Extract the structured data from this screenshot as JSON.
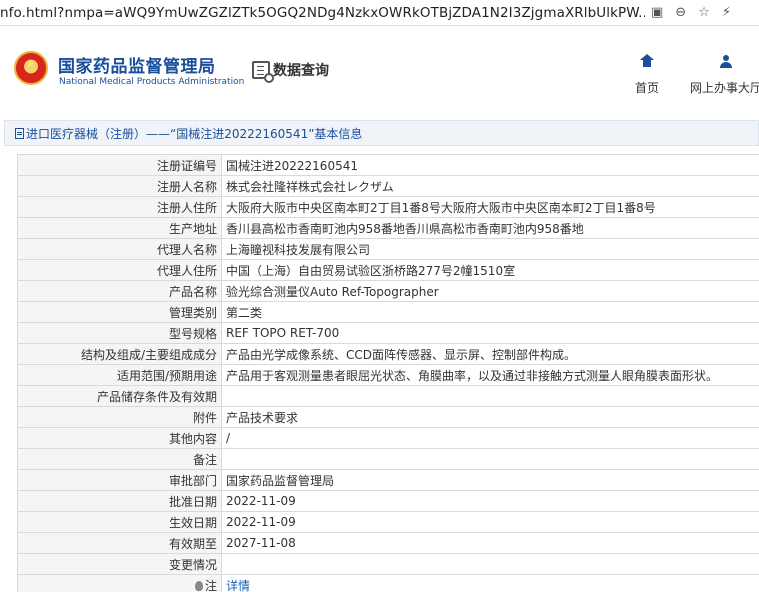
{
  "browser": {
    "url": "nfo.html?nmpa=aWQ9YmUwZGZlZTk5OGQ2NDg4NzkxOWRkOTBjZDA1N2I3ZjgmaXRlbUlkPW...",
    "icons": [
      "image-icon",
      "zoom-icon",
      "bookmark-star-icon",
      "extension-icon"
    ]
  },
  "header": {
    "org_name_cn": "国家药品监督管理局",
    "org_name_en": "National Medical Products Administration",
    "query_label": "数据查询",
    "nav": [
      {
        "label": "首页",
        "icon": "home-icon"
      },
      {
        "label": "网上办事大厅",
        "icon": "user-icon"
      }
    ]
  },
  "breadcrumb": {
    "text": "进口医疗器械（注册）——“国械注进20222160541”基本信息"
  },
  "details": [
    {
      "label": "注册证编号",
      "value": "国械注进20222160541"
    },
    {
      "label": "注册人名称",
      "value": "株式会社隆祥株式会社レクザム"
    },
    {
      "label": "注册人住所",
      "value": "大阪府大阪市中央区南本町2丁目1番8号大阪府大阪市中央区南本町2丁目1番8号"
    },
    {
      "label": "生产地址",
      "value": "香川县高松市香南町池内958番地香川県高松市香南町池内958番地"
    },
    {
      "label": "代理人名称",
      "value": "上海瞳视科技发展有限公司"
    },
    {
      "label": "代理人住所",
      "value": "中国（上海）自由贸易试验区浙桥路277号2幢1510室"
    },
    {
      "label": "产品名称",
      "value": "验光综合测量仪Auto Ref-Topographer"
    },
    {
      "label": "管理类别",
      "value": "第二类"
    },
    {
      "label": "型号规格",
      "value": "REF TOPO RET-700"
    },
    {
      "label": "结构及组成/主要组成成分",
      "value": "产品由光学成像系统、CCD面阵传感器、显示屏、控制部件构成。"
    },
    {
      "label": "适用范围/预期用途",
      "value": "产品用于客观测量患者眼屈光状态、角膜曲率，以及通过非接触方式测量人眼角膜表面形状。"
    },
    {
      "label": "产品储存条件及有效期",
      "value": ""
    },
    {
      "label": "附件",
      "value": "产品技术要求"
    },
    {
      "label": "其他内容",
      "value": "/"
    },
    {
      "label": "备注",
      "value": ""
    },
    {
      "label": "审批部门",
      "value": "国家药品监督管理局"
    },
    {
      "label": "批准日期",
      "value": "2022-11-09"
    },
    {
      "label": "生效日期",
      "value": "2022-11-09"
    },
    {
      "label": "有效期至",
      "value": "2027-11-08"
    },
    {
      "label": "变更情况",
      "value": ""
    }
  ],
  "note_row": {
    "label": "注",
    "link_text": "详情"
  }
}
